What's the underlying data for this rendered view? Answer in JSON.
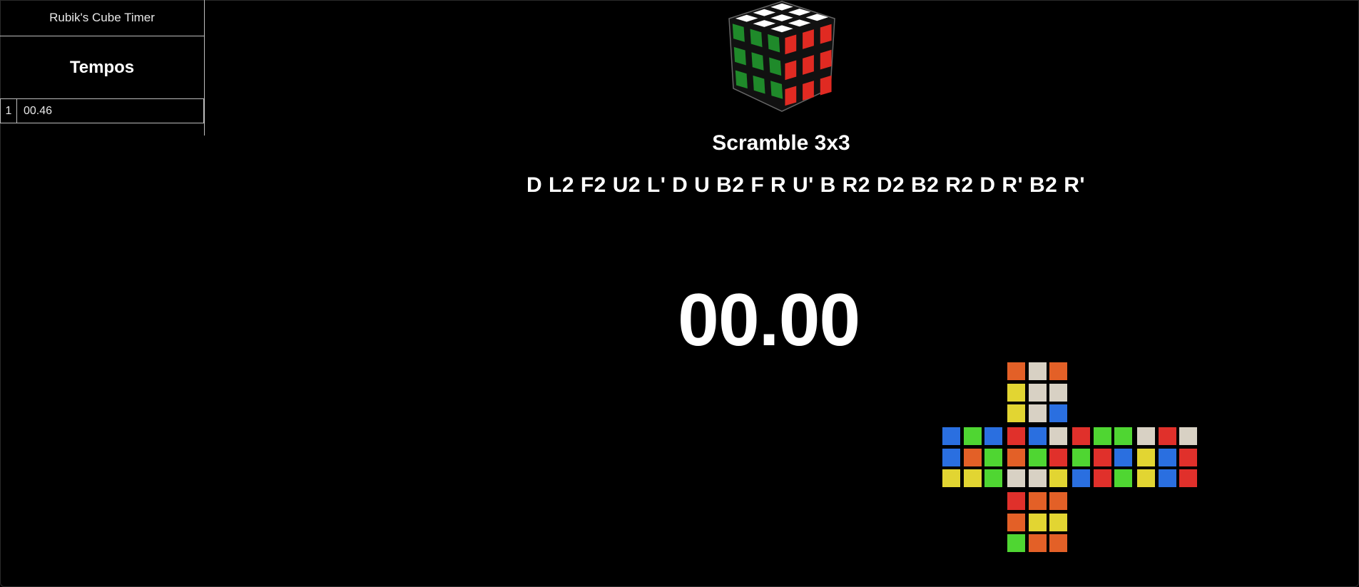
{
  "app": {
    "title": "Rubik's Cube Timer"
  },
  "sidebar": {
    "heading": "Tempos",
    "times": [
      {
        "index": "1",
        "time": "00.46"
      }
    ]
  },
  "main": {
    "scramble_title": "Scramble 3x3",
    "scramble_moves": "D L2 F2 U2 L' D U B2 F R U' B R2 D2 B2 R2 D R' B2 R'",
    "timer": "00.00"
  },
  "colors": {
    "white": "#d8d1c4",
    "yellow": "#e2d532",
    "red": "#e0302b",
    "orange": "#e36027",
    "blue": "#2a6fe0",
    "green": "#4fd632",
    "background": "#000000"
  },
  "cube_icon": {
    "top_color": "#ffffff",
    "left_color": "#1f8a2a",
    "right_color": "#e02a22"
  },
  "scramble_net": {
    "U": [
      "orange",
      "white",
      "orange",
      "yellow",
      "white",
      "white",
      "yellow",
      "white",
      "blue"
    ],
    "L": [
      "blue",
      "green",
      "blue",
      "blue",
      "orange",
      "green",
      "yellow",
      "yellow",
      "green"
    ],
    "F": [
      "red",
      "blue",
      "white",
      "orange",
      "green",
      "red",
      "white",
      "white",
      "yellow"
    ],
    "R": [
      "red",
      "green",
      "green",
      "green",
      "red",
      "blue",
      "blue",
      "red",
      "green"
    ],
    "B": [
      "white",
      "red",
      "white",
      "yellow",
      "blue",
      "red",
      "yellow",
      "blue",
      "red"
    ],
    "D": [
      "red",
      "orange",
      "orange",
      "orange",
      "yellow",
      "yellow",
      "green",
      "orange",
      "orange"
    ]
  }
}
